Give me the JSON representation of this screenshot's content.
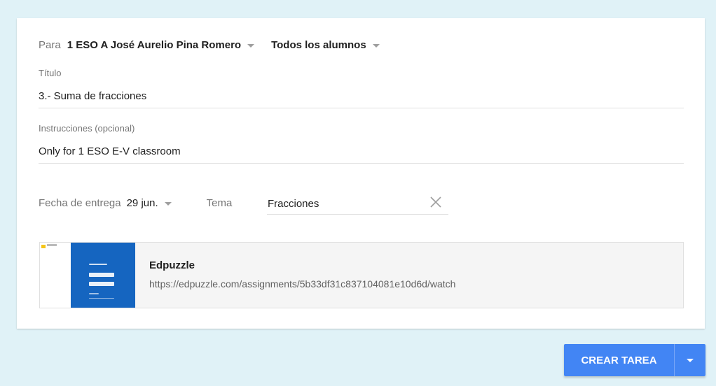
{
  "assign": {
    "para_label": "Para",
    "class_name": "1 ESO A José Aurelio Pina Romero",
    "students": "Todos los alumnos"
  },
  "titulo": {
    "label": "Título",
    "value": "3.- Suma de fracciones"
  },
  "instrucciones": {
    "label": "Instrucciones (opcional)",
    "value": "Only for 1 ESO E-V classroom"
  },
  "fecha": {
    "label": "Fecha de entrega",
    "value": "29 jun."
  },
  "tema": {
    "label": "Tema",
    "value": "Fracciones"
  },
  "attachment": {
    "title": "Edpuzzle",
    "url": "https://edpuzzle.com/assignments/5b33df31c837104081e10d6d/watch"
  },
  "actions": {
    "create_label": "CREAR TAREA"
  },
  "colors": {
    "accent": "#4285f4",
    "background": "#e0f2f7"
  }
}
